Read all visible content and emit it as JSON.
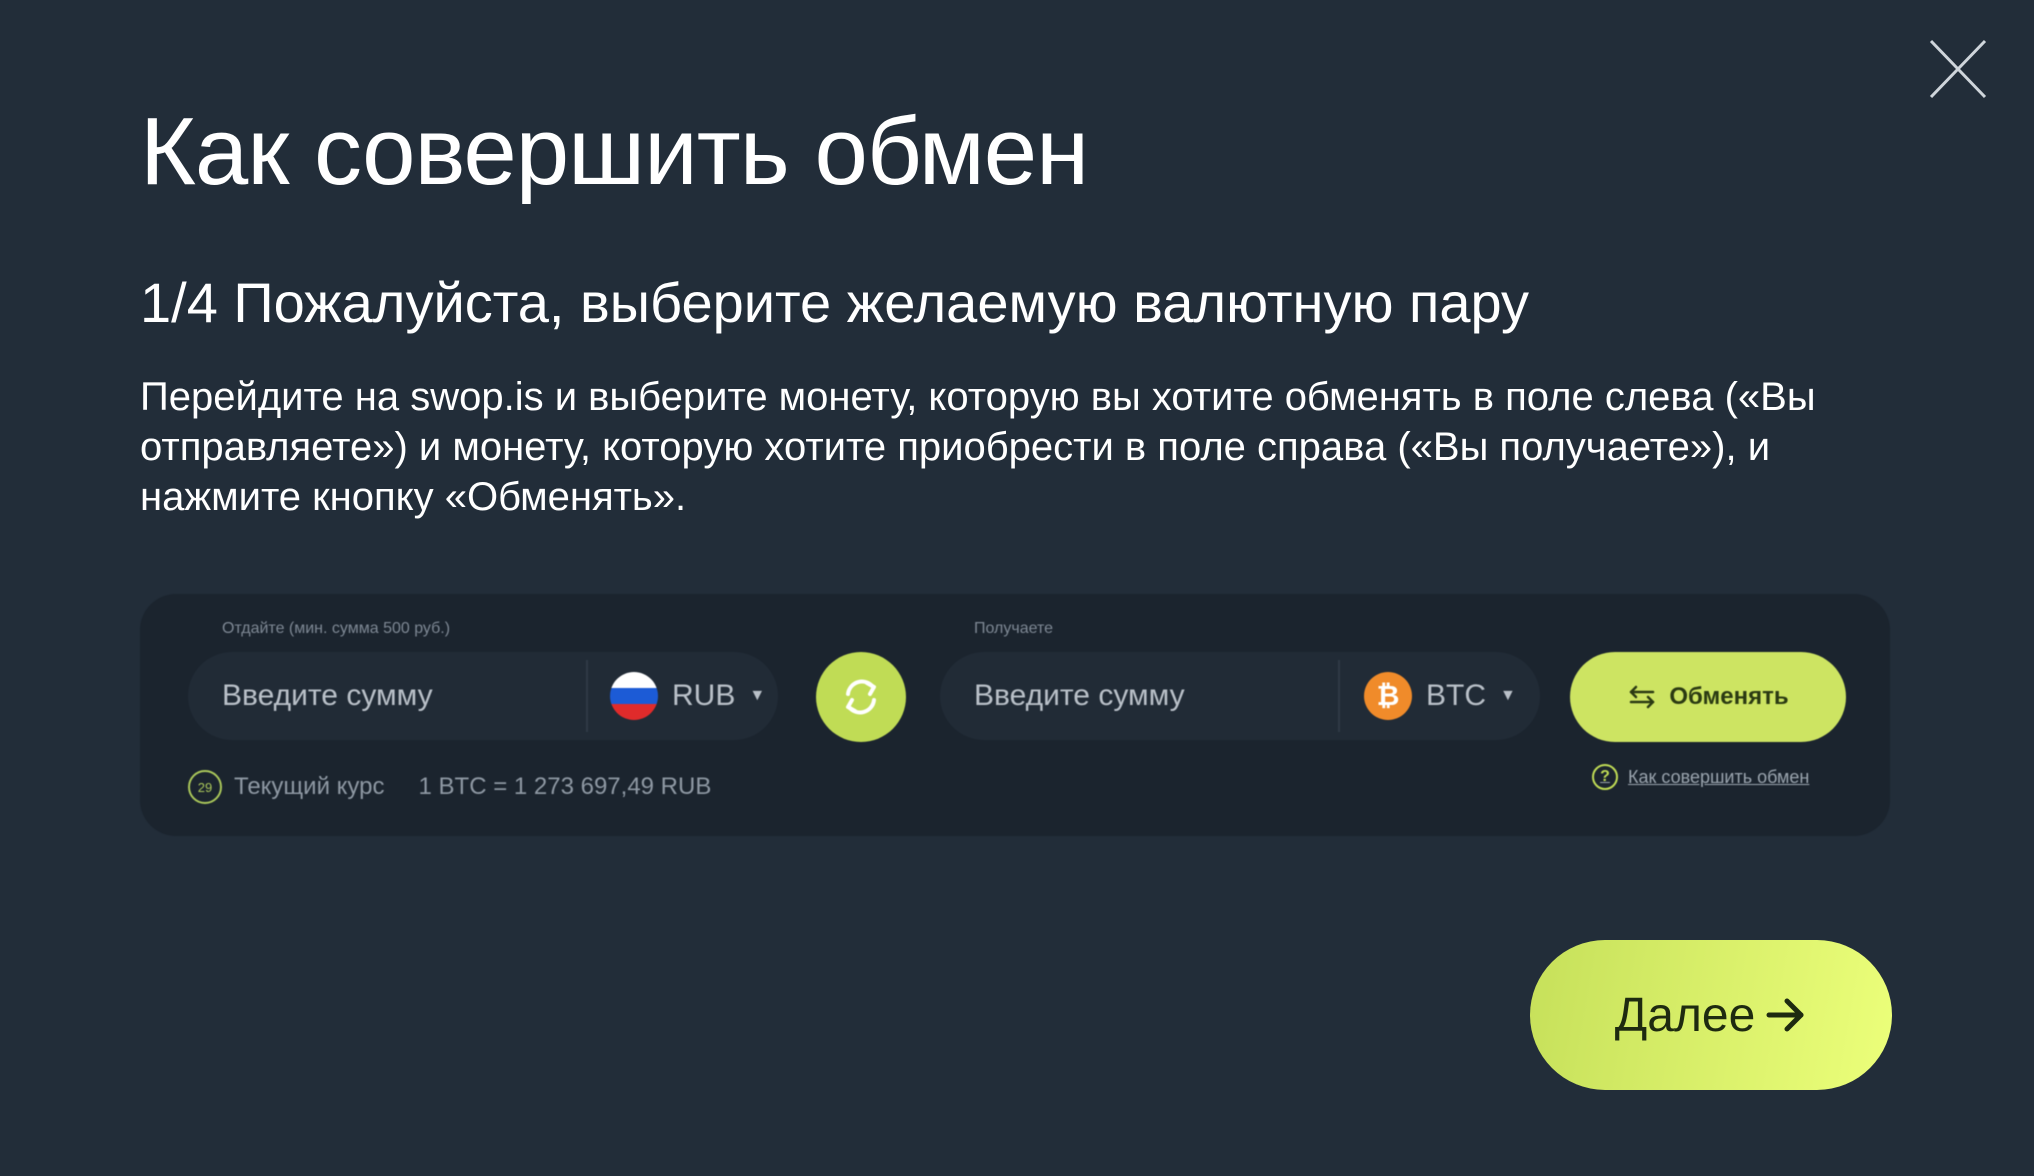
{
  "modal": {
    "title": "Как совершить обмен",
    "step_title": "1/4 Пожалуйста, выберите желаемую валютную пару",
    "description": "Перейдите на swop.is и выберите монету, которую вы хотите обменять в поле слева («Вы отправляете») и монету, которую хотите приобрести в поле справа («Вы получаете»), и нажмите кнопку «Обменять».",
    "close_icon": "close-icon",
    "next_label": "Далее",
    "next_icon": "arrow-right-icon"
  },
  "widget": {
    "send_label": "Отдайте (мин. сумма 500 руб.)",
    "send_placeholder": "Введите сумму",
    "send_currency": "RUB",
    "receive_label": "Получаете",
    "receive_placeholder": "Введите сумму",
    "receive_currency": "BTC",
    "exchange_label": "Обменять",
    "timer_value": "29",
    "rate_label": "Текущий курс",
    "rate_value": "1 BTC = 1 273 697,49 RUB",
    "howto_link": "Как совершить обмен",
    "colors": {
      "accent": "#c0dc55",
      "btc": "#f08b2a",
      "background": "#222d39",
      "widget_bg": "#1b242e"
    }
  }
}
